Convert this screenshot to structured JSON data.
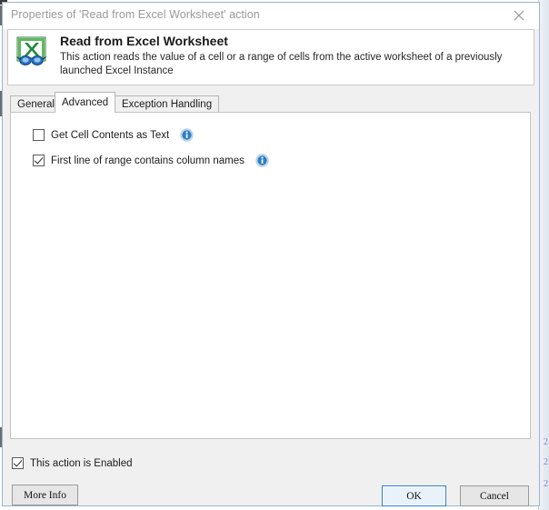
{
  "window": {
    "titlebar_text": "Properties of 'Read from Excel Worksheet' action",
    "close_icon": "close-icon"
  },
  "header": {
    "icon": "excel-read-worksheet-icon",
    "title": "Read from Excel Worksheet",
    "description": "This action reads the value of a cell or a range of cells from the active worksheet of a previously launched Excel Instance"
  },
  "tabs": [
    {
      "label": "General",
      "selected": false
    },
    {
      "label": "Advanced",
      "selected": true
    },
    {
      "label": "Exception Handling",
      "selected": false
    }
  ],
  "advanced_panel": {
    "options": [
      {
        "label": "Get Cell Contents as Text",
        "checked": false,
        "info_icon": "info-icon"
      },
      {
        "label": "First line of range contains column names",
        "checked": true,
        "info_icon": "info-icon"
      }
    ]
  },
  "footer": {
    "enabled_checkbox": {
      "label": "This action is Enabled",
      "checked": true
    },
    "more_info_label": "More Info",
    "ok_label": "OK",
    "cancel_label": "Cancel"
  },
  "colors": {
    "dialog_background": "#f0f0f0",
    "panel_background": "#ffffff",
    "title_text": "#9a9a9a",
    "accent_focus": "#2c80d8",
    "info_blue": "#2f7fc4",
    "excel_green": "#1f8a3c"
  },
  "artifacts": {
    "right_edge_glyphs": [
      "2",
      "2",
      "2"
    ]
  }
}
